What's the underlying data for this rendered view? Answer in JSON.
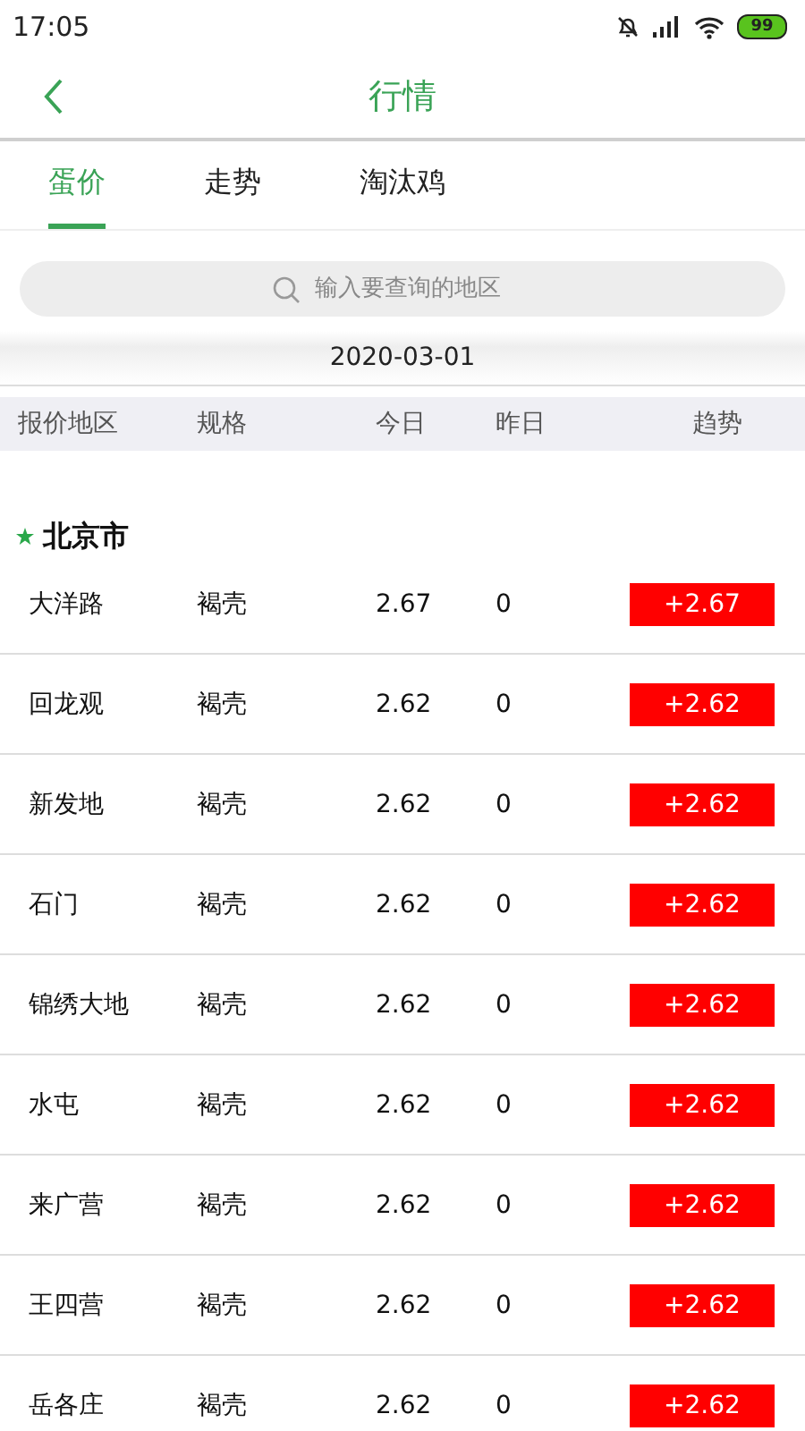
{
  "status_bar": {
    "time": "17:05",
    "battery": "99"
  },
  "header": {
    "title": "行情"
  },
  "tabs": [
    {
      "label": "蛋价",
      "selected": true
    },
    {
      "label": "走势",
      "selected": false
    },
    {
      "label": "淘汰鸡",
      "selected": false
    }
  ],
  "search": {
    "placeholder": "输入要查询的地区"
  },
  "date": "2020-03-01",
  "table": {
    "columns": [
      "报价地区",
      "规格",
      "今日",
      "昨日",
      "趋势"
    ],
    "section": "北京市",
    "rows": [
      {
        "area": "大洋路",
        "spec": "褐壳",
        "today": "2.67",
        "yesterday": "0",
        "trend": "+2.67"
      },
      {
        "area": "回龙观",
        "spec": "褐壳",
        "today": "2.62",
        "yesterday": "0",
        "trend": "+2.62"
      },
      {
        "area": "新发地",
        "spec": "褐壳",
        "today": "2.62",
        "yesterday": "0",
        "trend": "+2.62"
      },
      {
        "area": "石门",
        "spec": "褐壳",
        "today": "2.62",
        "yesterday": "0",
        "trend": "+2.62"
      },
      {
        "area": "锦绣大地",
        "spec": "褐壳",
        "today": "2.62",
        "yesterday": "0",
        "trend": "+2.62"
      },
      {
        "area": "水屯",
        "spec": "褐壳",
        "today": "2.62",
        "yesterday": "0",
        "trend": "+2.62"
      },
      {
        "area": "来广营",
        "spec": "褐壳",
        "today": "2.62",
        "yesterday": "0",
        "trend": "+2.62"
      },
      {
        "area": "王四营",
        "spec": "褐壳",
        "today": "2.62",
        "yesterday": "0",
        "trend": "+2.62"
      },
      {
        "area": "岳各庄",
        "spec": "褐壳",
        "today": "2.62",
        "yesterday": "0",
        "trend": "+2.62"
      }
    ]
  }
}
